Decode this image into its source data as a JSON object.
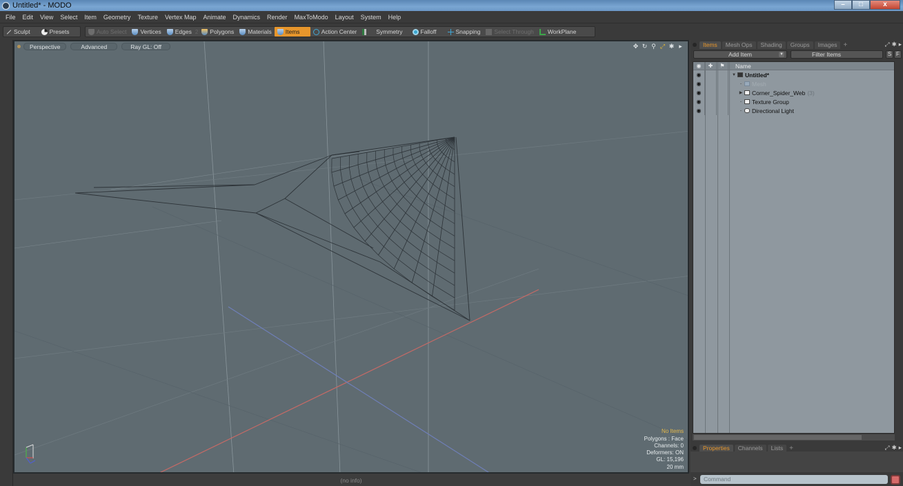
{
  "window": {
    "title": "Untitled* - MODO",
    "minimize": "–",
    "maximize": "□",
    "close": "x"
  },
  "menu": [
    "File",
    "Edit",
    "View",
    "Select",
    "Item",
    "Geometry",
    "Texture",
    "Vertex Map",
    "Animate",
    "Dynamics",
    "Render",
    "MaxToModo",
    "Layout",
    "System",
    "Help"
  ],
  "toolbar": {
    "sculpt": "Sculpt",
    "presets": "Presets",
    "auto_select": "Auto Select",
    "vertices": "Vertices",
    "edges": "Edges",
    "edges_count": "2",
    "polygons": "Polygons",
    "materials": "Materials",
    "items": "Items",
    "action_center": "Action Center",
    "symmetry": "Symmetry",
    "falloff": "Falloff",
    "snapping": "Snapping",
    "select_through": "Select Through",
    "workplane": "WorkPlane"
  },
  "viewport": {
    "view_mode": "Perspective",
    "shading": "Advanced",
    "ray_gl": "Ray GL: Off",
    "icons": [
      "move-view-icon",
      "rotate-view-icon",
      "zoom-view-icon",
      "fit-icon",
      "gear-icon",
      "more-icon"
    ],
    "info": {
      "selection": "No Items",
      "polygons": "Polygons : Face",
      "channels": "Channels: 0",
      "deformers": "Deformers: ON",
      "gl": "GL: 15,196",
      "unit": "20 mm"
    },
    "colors": {
      "background": "#5f6b71",
      "x_axis": "#c56a66",
      "z_axis": "#6f7fb8",
      "wire": "#2d3338"
    }
  },
  "status": "(no info)",
  "items_panel": {
    "tabs": [
      "Items",
      "Mesh Ops",
      "Shading",
      "Groups",
      "Images"
    ],
    "active_tab": "Items",
    "add_item": "Add Item",
    "filter": "Filter Items",
    "s_btn": "S",
    "f_btn": "F",
    "name_header": "Name",
    "tree": [
      {
        "name": "Untitled*",
        "type": "scene",
        "bold": true,
        "expanded": true
      },
      {
        "name": "Mesh",
        "type": "mesh",
        "dim": true
      },
      {
        "name": "Corner_Spider_Web",
        "type": "group",
        "count": "(3)",
        "collapsed": true
      },
      {
        "name": "Texture Group",
        "type": "group"
      },
      {
        "name": "Directional Light",
        "type": "light"
      }
    ]
  },
  "properties_panel": {
    "tabs": [
      "Properties",
      "Channels",
      "Lists"
    ],
    "active_tab": "Properties"
  },
  "command": {
    "placeholder": "Command",
    "prompt": ">"
  }
}
